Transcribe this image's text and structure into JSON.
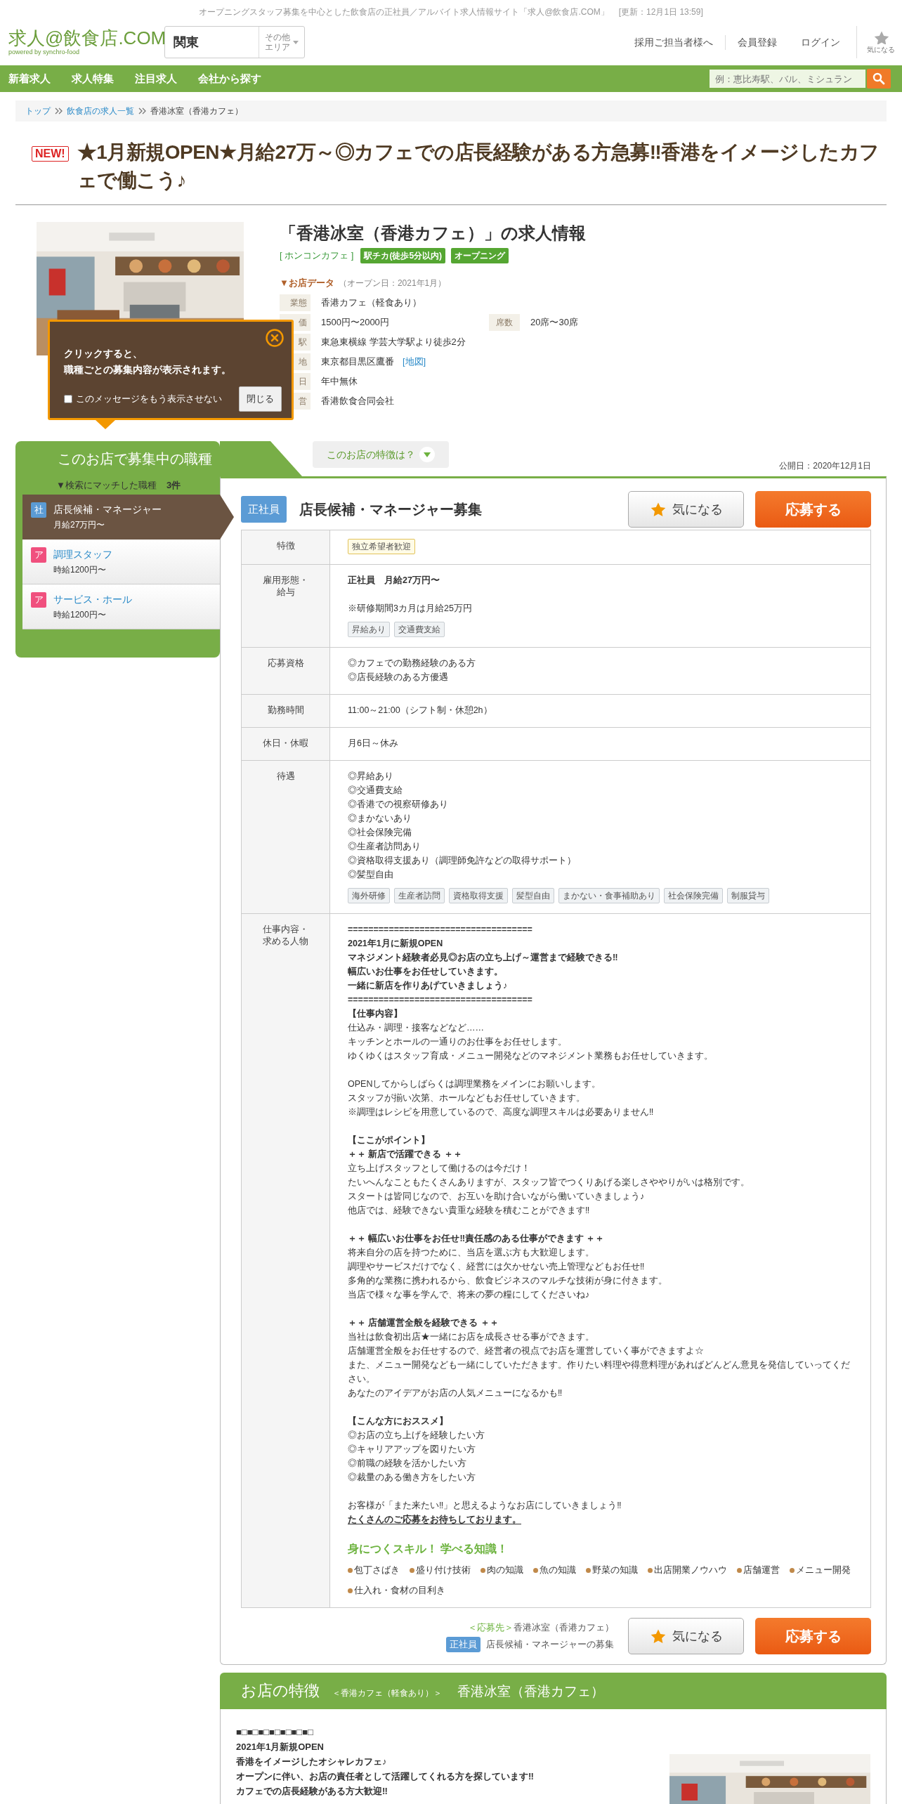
{
  "header": {
    "tagline": "オープニングスタッフ募集を中心とした飲食店の正社員／アルバイト求人情報サイト「求人@飲食店.COM」",
    "updated": "[更新：12月1日 13:59]",
    "logo": "求人@飲食店.COM",
    "logo_sub": "powered by synchro-food",
    "area": "関東",
    "other_area": "その他エリア",
    "links": [
      "採用ご担当者様へ",
      "会員登録",
      "ログイン"
    ],
    "favorites": "気になる"
  },
  "nav": {
    "items": [
      "新着求人",
      "求人特集",
      "注目求人",
      "会社から探す"
    ],
    "search_placeholder": "例：恵比寿駅、バル、ミシュラン"
  },
  "breadcrumb": [
    {
      "text": "トップ",
      "link": true
    },
    {
      "text": "飲食店の求人一覧",
      "link": true
    },
    {
      "text": "香港冰室（香港カフェ）",
      "link": false
    }
  ],
  "title": {
    "badge": "NEW!",
    "text": "★1月新規OPEN★月給27万～◎カフェでの店長経験がある方急募‼香港をイメージしたカフェで働こう♪"
  },
  "shop": {
    "title": "「香港冰室（香港カフェ）」の求人情報",
    "category": "[ ホンコンカフェ ]",
    "tags": [
      "駅チカ(徒歩5分以内)",
      "オープニング"
    ],
    "data_heading": "▼お店データ",
    "open_date": "（オープン日：2021年1月）",
    "rows": [
      {
        "label": "業態",
        "value": "香港カフェ（軽食あり）"
      },
      {
        "label": "価",
        "value": "1500円〜2000円",
        "extra_label": "席数",
        "extra_value": "20席〜30席"
      },
      {
        "label": "駅",
        "value": "東急東横線 学芸大学駅より徒歩2分"
      },
      {
        "label": "地",
        "value": "東京都目黒区鷹番",
        "link": "[地図]"
      },
      {
        "label": "日",
        "value": "年中無休"
      },
      {
        "label": "営",
        "value": "香港飲食合同会社"
      }
    ]
  },
  "popover": {
    "message": [
      "クリックすると、",
      "職種ごとの募集内容が表示されます。"
    ],
    "dont_show": {
      "label": "このメッセージをもう表示させない",
      "checked": false
    },
    "close_button": "閉じる"
  },
  "sidebar": {
    "heading": "このお店で募集中の職種",
    "match_label": "▼検索にマッチした職種",
    "match_count": "3件",
    "jobs": [
      {
        "badge": "社",
        "color": "#5b9bd5",
        "title": "店長候補・マネージャー",
        "salary": "月給27万円〜",
        "selected": true
      },
      {
        "badge": "ア",
        "color": "#f0507e",
        "title": "調理スタッフ",
        "salary": "時給1200円〜",
        "selected": false
      },
      {
        "badge": "ア",
        "color": "#f0507e",
        "title": "サービス・ホール",
        "salary": "時給1200円〜",
        "selected": false
      }
    ]
  },
  "features_tab": "このお店の特徴は？",
  "published": "公開日：2020年12月1日",
  "job": {
    "badge": "正社員",
    "title": "店長候補・マネージャー募集",
    "favorite_button": "気になる",
    "apply_button": "応募する",
    "rows": [
      {
        "label": [
          "特徴"
        ],
        "kind": "highlight",
        "tags": [
          "独立希望者歓迎"
        ]
      },
      {
        "label": [
          "雇用形態・",
          "給与"
        ],
        "paragraphs": [
          [
            {
              "text": "正社員　月給27万円〜",
              "kind": "bold"
            }
          ],
          [
            {
              "text": "※研修期間3カ月は月給25万円",
              "kind": "plain"
            }
          ]
        ],
        "kind": "plain",
        "tags": [
          "昇給あり",
          "交通費支給"
        ]
      },
      {
        "label": [
          "応募資格"
        ],
        "paragraphs": [
          [
            {
              "text": "◎カフェでの勤務経験のある方",
              "kind": "plain"
            },
            {
              "text": "◎店長経験のある方優遇",
              "kind": "plain"
            }
          ]
        ]
      },
      {
        "label": [
          "勤務時間"
        ],
        "paragraphs": [
          [
            {
              "text": "11:00～21:00（シフト制・休憩2h）",
              "kind": "plain"
            }
          ]
        ]
      },
      {
        "label": [
          "休日・休暇"
        ],
        "paragraphs": [
          [
            {
              "text": "月6日～休み",
              "kind": "plain"
            }
          ]
        ]
      },
      {
        "label": [
          "待遇"
        ],
        "paragraphs": [
          [
            {
              "text": "◎昇給あり",
              "kind": "plain"
            },
            {
              "text": "◎交通費支給",
              "kind": "plain"
            },
            {
              "text": "◎香港での視察研修あり",
              "kind": "plain"
            },
            {
              "text": "◎まかないあり",
              "kind": "plain"
            },
            {
              "text": "◎社会保険完備",
              "kind": "plain"
            },
            {
              "text": "◎生産者訪問あり",
              "kind": "plain"
            },
            {
              "text": "◎資格取得支援あり（調理師免許などの取得サポート）",
              "kind": "plain"
            },
            {
              "text": "◎髪型自由",
              "kind": "plain"
            }
          ]
        ],
        "kind": "plain",
        "tags": [
          "海外研修",
          "生産者訪問",
          "資格取得支援",
          "髪型自由",
          "まかない・食事補助あり",
          "社会保険完備",
          "制服貸与"
        ]
      },
      {
        "label": [
          "仕事内容・",
          "求める人物"
        ],
        "paragraphs": [
          [
            {
              "text": "====================================",
              "kind": "bold"
            },
            {
              "text": "2021年1月に新規OPEN",
              "kind": "bold"
            },
            {
              "text": "マネジメント経験者必見◎お店の立ち上げ～運営まで経験できる‼",
              "kind": "bold"
            },
            {
              "text": "幅広いお仕事をお任せしていきます。",
              "kind": "bold"
            },
            {
              "text": "一緒に新店を作りあげていきましょう♪",
              "kind": "bold"
            },
            {
              "text": "====================================",
              "kind": "bold"
            },
            {
              "text": "【仕事内容】",
              "kind": "bold"
            },
            {
              "text": "仕込み・調理・接客などなど……",
              "kind": "plain"
            },
            {
              "text": "キッチンとホールの一通りのお仕事をお任せします。",
              "kind": "plain"
            },
            {
              "text": "ゆくゆくはスタッフ育成・メニュー開発などのマネジメント業務もお任せしていきます。",
              "kind": "plain"
            }
          ],
          [
            {
              "text": "OPENしてからしばらくは調理業務をメインにお願いします。",
              "kind": "plain"
            },
            {
              "text": "スタッフが揃い次第、ホールなどもお任せしていきます。",
              "kind": "plain"
            },
            {
              "text": "※調理はレシピを用意しているので、高度な調理スキルは必要ありません‼",
              "kind": "plain"
            }
          ],
          [
            {
              "text": "【ここがポイント】",
              "kind": "bold"
            },
            {
              "text": "＋＋ 新店で活躍できる ＋＋",
              "kind": "bold"
            },
            {
              "text": "立ち上げスタッフとして働けるのは今だけ！",
              "kind": "plain"
            },
            {
              "text": "たいへんなこともたくさんありますが、スタッフ皆でつくりあげる楽しさややりがいは格別です。",
              "kind": "plain"
            },
            {
              "text": "スタートは皆同じなので、お互いを助け合いながら働いていきましょう♪",
              "kind": "plain"
            },
            {
              "text": "他店では、経験できない貴重な経験を積むことができます‼",
              "kind": "plain"
            }
          ],
          [
            {
              "text": "＋＋ 幅広いお仕事をお任せ‼責任感のある仕事ができます ＋＋",
              "kind": "bold"
            },
            {
              "text": "将来自分の店を持つために、当店を選ぶ方も大歓迎します。",
              "kind": "plain"
            },
            {
              "text": "調理やサービスだけでなく、経営には欠かせない売上管理などもお任せ‼",
              "kind": "plain"
            },
            {
              "text": "多角的な業務に携われるから、飲食ビジネスのマルチな技術が身に付きます。",
              "kind": "plain"
            },
            {
              "text": "当店で様々な事を学んで、将来の夢の糧にしてくださいね♪",
              "kind": "plain"
            }
          ],
          [
            {
              "text": "＋＋ 店舗運営全般を経験できる ＋＋",
              "kind": "bold"
            },
            {
              "text": "当社は飲食初出店★一緒にお店を成長させる事ができます。",
              "kind": "plain"
            },
            {
              "text": "店舗運営全般をお任せするので、経営者の視点でお店を運営していく事ができますよ☆",
              "kind": "plain"
            },
            {
              "text": "また、メニュー開発なども一緒にしていただきます。作りたい料理や得意料理があればどんどん意見を発信していってください。",
              "kind": "plain"
            },
            {
              "text": "あなたのアイデアがお店の人気メニューになるかも‼",
              "kind": "plain"
            }
          ],
          [
            {
              "text": "【こんな方におススメ】",
              "kind": "bold"
            },
            {
              "text": "◎お店の立ち上げを経験したい方",
              "kind": "plain"
            },
            {
              "text": "◎キャリアアップを図りたい方",
              "kind": "plain"
            },
            {
              "text": "◎前職の経験を活かしたい方",
              "kind": "plain"
            },
            {
              "text": "◎裁量のある働き方をしたい方",
              "kind": "plain"
            }
          ],
          [
            {
              "text": "お客様が「また来たい‼」と思えるようなお店にしていきましょう‼",
              "kind": "plain"
            },
            {
              "text": "たくさんのご応募をお待ちしております。",
              "kind": "bold_underline"
            }
          ]
        ],
        "skills": {
          "heading": "身につくスキル！ 学べる知識！",
          "items": [
            "包丁さばき",
            "盛り付け技術",
            "肉の知識",
            "魚の知識",
            "野菜の知識",
            "出店開業ノウハウ",
            "店舗運営",
            "メニュー開発",
            "仕入れ・食材の目利き"
          ]
        }
      }
    ]
  },
  "apply_footer": {
    "label": "＜応募先＞",
    "shop": "香港冰室（香港カフェ）",
    "badge": "正社員",
    "job": "店長候補・マネージャーの募集",
    "favorite_button": "気になる",
    "apply_button": "応募する"
  },
  "shop_features": {
    "heading": "お店の特徴",
    "category": "＜香港カフェ（軽食あり）＞",
    "name": "香港冰室（香港カフェ）",
    "lines": [
      "■□■□■□■□■□■□■□",
      "2021年1月新規OPEN",
      "香港をイメージしたオシャレカフェ♪",
      "オープンに伴い、お店の責任者として活躍してくれる方を探しています‼",
      "カフェでの店長経験がある方大歓迎‼"
    ]
  }
}
